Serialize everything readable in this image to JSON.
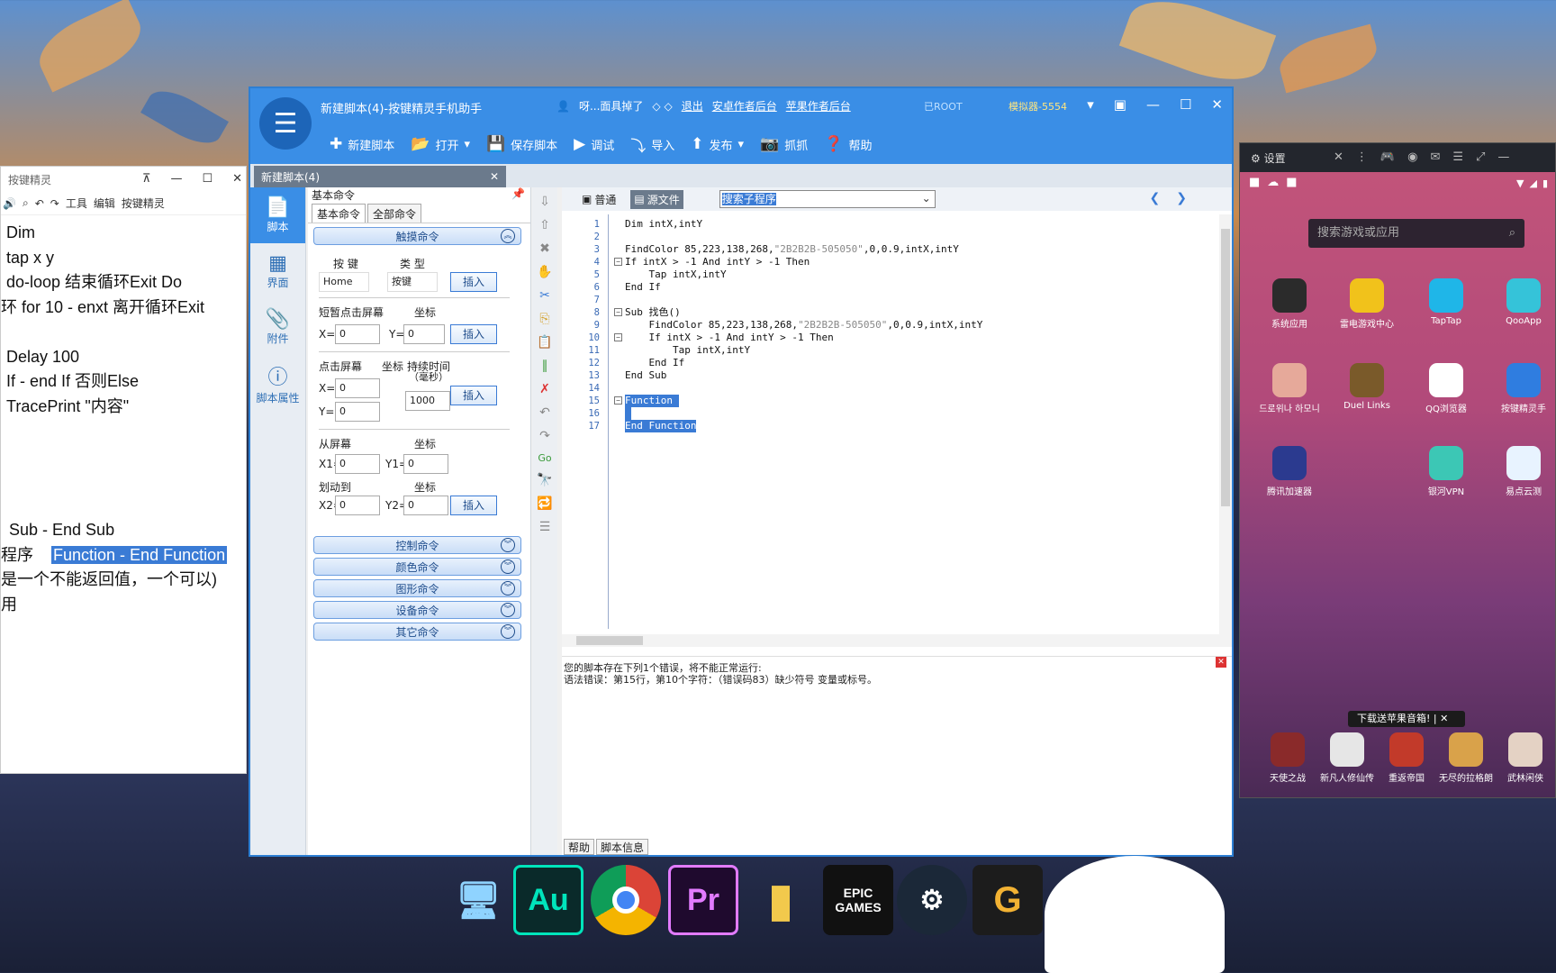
{
  "notepad": {
    "title": "按键精灵",
    "toolbar": [
      "工具",
      "编辑",
      "按键精灵"
    ],
    "lines": [
      "Dim",
      "tap x y",
      "do-loop    结束循环Exit Do",
      "环    for 10 - enxt    离开循环Exit",
      "",
      "Delay 100",
      "If - end If     否则Else",
      "TracePrint \"内容\"",
      "",
      "",
      "",
      "",
      "Sub - End Sub",
      "程序"
    ],
    "highlight": "Function - End Function",
    "line14": "是一个不能返回值，一个可以)",
    "line15": "用"
  },
  "main": {
    "title": "新建脚本(4)-按键精灵手机助手",
    "top_links": [
      "呀...面具掉了",
      "退出",
      "安卓作者后台",
      "苹果作者后台"
    ],
    "root": "已ROOT",
    "emulator": "模拟器-5554",
    "toolbar": [
      "新建脚本",
      "打开",
      "保存脚本",
      "调试",
      "导入",
      "发布",
      "抓抓",
      "帮助"
    ],
    "doc_tab": "新建脚本(4)",
    "nav": [
      "脚本",
      "界面",
      "附件",
      "脚本属性"
    ],
    "panel": {
      "head": "基本命令",
      "tabs": [
        "基本命令",
        "全部命令"
      ],
      "cat_touch": "触摸命令",
      "key_label": "按 键",
      "type_label": "类 型",
      "key_value": "Home",
      "type_value": "按键",
      "insert": "插入",
      "tap_label": "短暂点击屏幕",
      "coord": "坐标",
      "x_label": "X=",
      "y_label": "Y=",
      "zero": "0",
      "press_label": "点击屏幕",
      "duration_label": "持续时间",
      "duration_unit": "（毫秒）",
      "duration_value": "1000",
      "from_label": "从屏幕",
      "swipe_label": "划动到",
      "x1": "X1=",
      "y1": "Y1=",
      "x2": "X2=",
      "y2": "Y2=",
      "cats": [
        "控制命令",
        "颜色命令",
        "图形命令",
        "设备命令",
        "其它命令"
      ]
    },
    "editor": {
      "mode_normal": "普通",
      "mode_source": "源文件",
      "sub_select": "搜索子程序",
      "lines": [
        "Dim intX,intY",
        "",
        "FindColor 85,223,138,268,\"2B2B2B-505050\",0,0.9,intX,intY",
        "If intX > -1 And intY > -1 Then",
        "    Tap intX,intY",
        "End If",
        "",
        "Sub 找色()",
        "    FindColor 85,223,138,268,\"2B2B2B-505050\",0,0.9,intX,intY",
        "    If intX > -1 And intY > -1 Then",
        "        Tap intX,intY",
        "    End If",
        "End Sub",
        "",
        "Function ",
        " ",
        "End Function"
      ],
      "output1": "您的脚本存在下列1个错误，将不能正常运行:",
      "output2": "语法错误：第15行，第10个字符：（错误码83）缺少符号 变量或标号。",
      "bottom_tabs": [
        "帮助",
        "脚本信息"
      ]
    }
  },
  "emulator": {
    "tab": "设置",
    "search_placeholder": "搜索游戏或应用",
    "apps": [
      "系统应用",
      "雷电游戏中心",
      "TapTap",
      "QooApp",
      "드로위나 하모니",
      "Duel Links",
      "QQ浏览器",
      "按键精灵手",
      "腾讯加速器",
      "",
      "银河VPN",
      "易点云测"
    ],
    "banner": "下载送苹果音箱!",
    "dock": [
      "天使之战",
      "新凡人修仙传",
      "重返帝国",
      "无尽的拉格朗",
      "武林闲侠"
    ]
  },
  "taskbar": [
    "Au",
    "Pr",
    "EPIC GAMES"
  ]
}
